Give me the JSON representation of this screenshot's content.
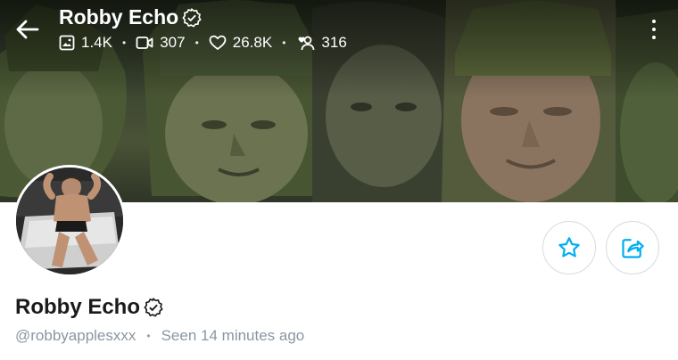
{
  "header": {
    "display_name": "Robby Echo",
    "stats": [
      {
        "icon": "image-icon",
        "value": "1.4K"
      },
      {
        "icon": "video-icon",
        "value": "307"
      },
      {
        "icon": "heart-icon",
        "value": "26.8K"
      },
      {
        "icon": "fans-icon",
        "value": "316"
      }
    ]
  },
  "profile": {
    "name": "Robby Echo",
    "username": "@robbyapplesxxx",
    "last_seen": "Seen 14 minutes ago"
  },
  "colors": {
    "accent": "#00aff0",
    "muted_text": "#8a96a3",
    "border": "#d7dbe0"
  }
}
